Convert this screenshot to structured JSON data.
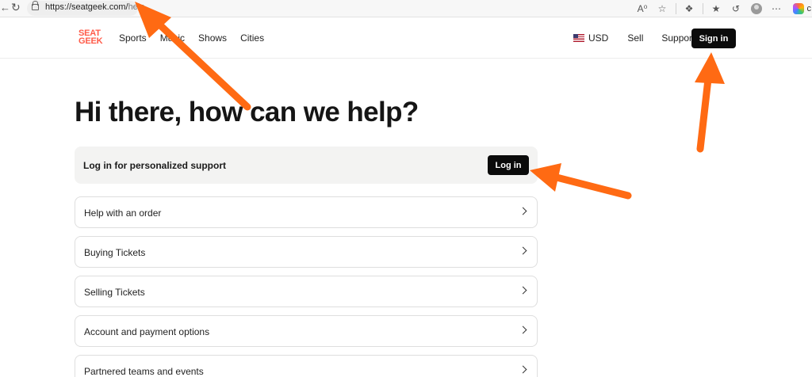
{
  "browser": {
    "url_host": "https://seatgeek.com/",
    "url_path": "help",
    "cut_text": "c"
  },
  "header": {
    "logo_line1": "SEAT",
    "logo_line2": "GEEK",
    "nav": [
      "Sports",
      "Music",
      "Shows",
      "Cities"
    ],
    "currency": "USD",
    "sell": "Sell",
    "support": "Support",
    "signin": "Sign in"
  },
  "main": {
    "headline": "Hi there, how can we help?",
    "login_prompt": "Log in for personalized support",
    "login_button": "Log in",
    "topics": [
      "Help with an order",
      "Buying Tickets",
      "Selling Tickets",
      "Account and payment options",
      "Partnered teams and events"
    ]
  },
  "colors": {
    "brand": "#ff5b49",
    "arrow": "#ff6a13",
    "button": "#0b0b0b"
  },
  "icons": [
    "back-icon",
    "reload-icon",
    "lock-icon",
    "read-aloud-icon",
    "favorite-icon",
    "extensions-icon",
    "favorites-icon",
    "history-icon",
    "profile-icon",
    "copilot-icon",
    "chevron-right-icon"
  ]
}
